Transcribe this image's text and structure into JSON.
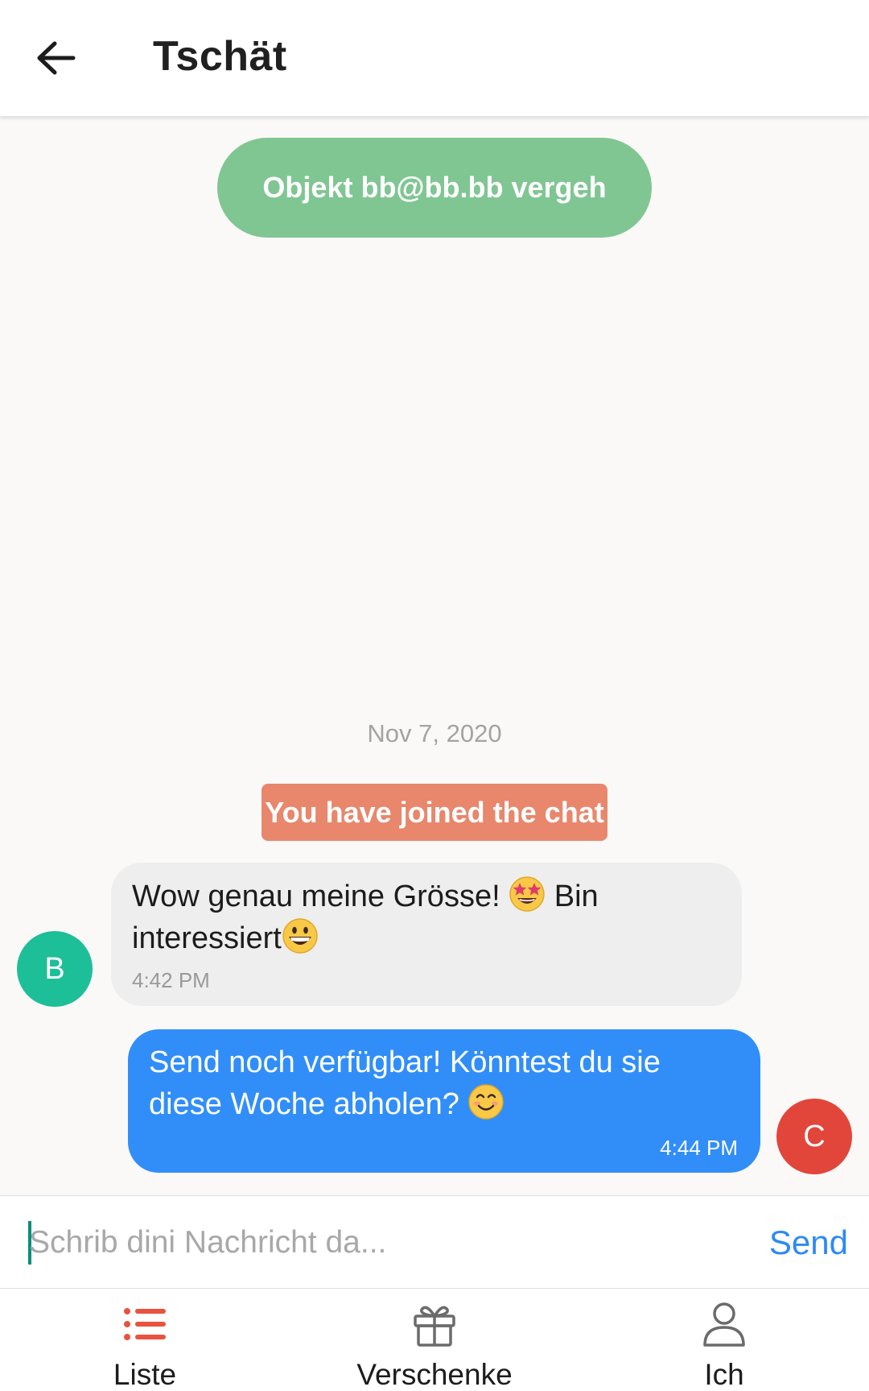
{
  "header": {
    "title": "Tschät",
    "back_icon": "arrow-left-icon"
  },
  "chat": {
    "status_pill": "Objekt bb@bb.bb vergeh",
    "date_separator": "Nov 7, 2020",
    "join_notice": "You have joined the chat",
    "messages": [
      {
        "sender_initial": "B",
        "direction": "incoming",
        "text_before_emoji": "Wow genau meine Grösse! ",
        "emoji_1": "star-struck-emoji",
        "text_middle": " Bin interessiert",
        "emoji_2": "grinning-face-emoji",
        "time": "4:42 PM"
      },
      {
        "sender_initial": "C",
        "direction": "outgoing",
        "text": "Send noch verfügbar! Könntest du sie diese Woche abholen? ",
        "emoji": "smiling-face-emoji",
        "time": "4:44 PM"
      }
    ]
  },
  "composer": {
    "placeholder": "Schrib dini Nachricht da...",
    "value": "",
    "send_label": "Send"
  },
  "bottom_nav": [
    {
      "label": "Liste",
      "icon": "list-icon",
      "active": true
    },
    {
      "label": "Verschenke",
      "icon": "gift-icon",
      "active": false
    },
    {
      "label": "Ich",
      "icon": "user-icon",
      "active": false
    }
  ],
  "colors": {
    "status_green": "#80c693",
    "join_orange": "#e8876c",
    "outgoing_blue": "#318ef8",
    "incoming_gray": "#eeeeee",
    "avatar_b": "#1dbf98",
    "avatar_c": "#e2463a",
    "accent_active": "#e8533f",
    "send_blue": "#2d8af3"
  }
}
